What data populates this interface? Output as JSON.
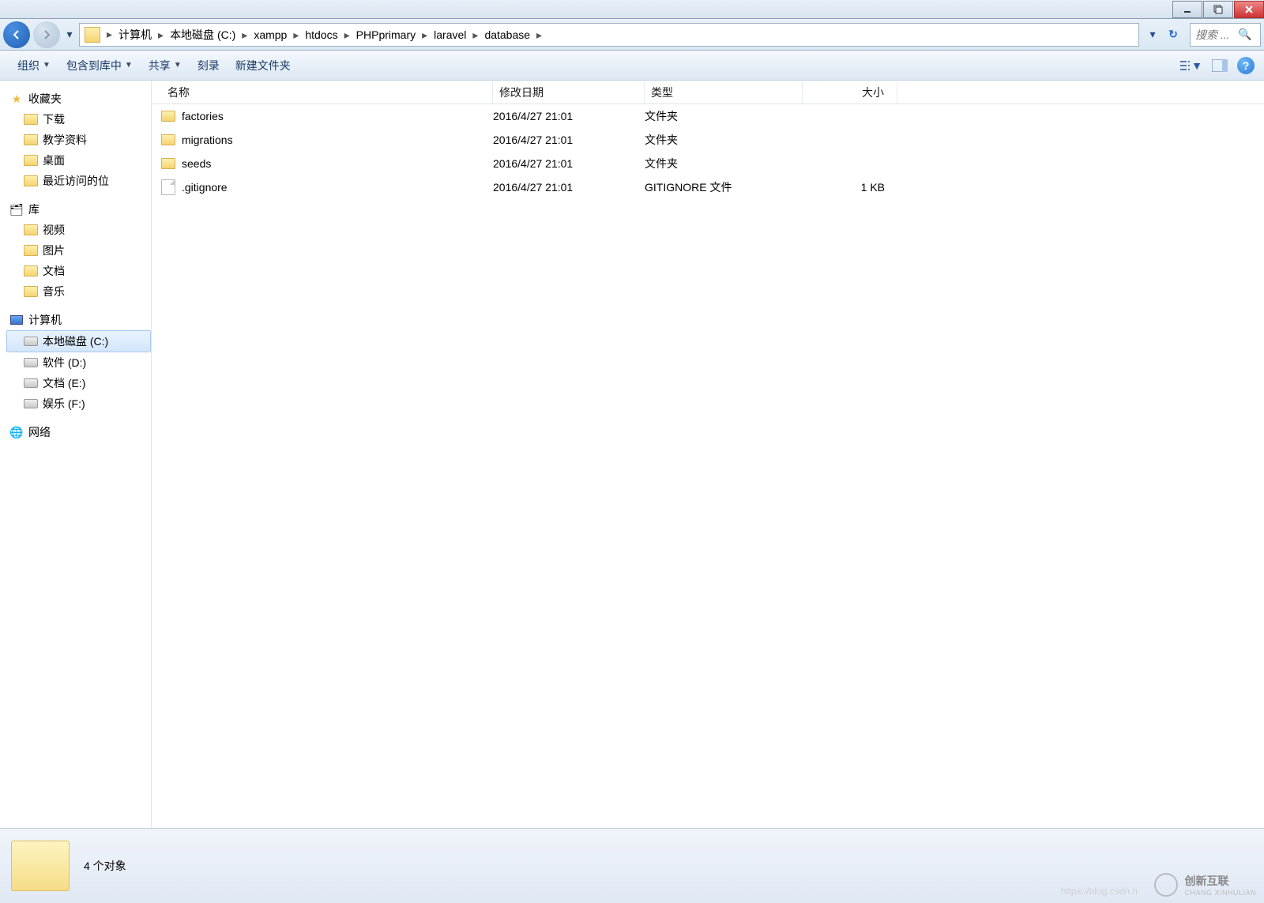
{
  "breadcrumbs": [
    "计算机",
    "本地磁盘 (C:)",
    "xampp",
    "htdocs",
    "PHPprimary",
    "laravel",
    "database"
  ],
  "search": {
    "placeholder": "搜索 ..."
  },
  "toolbar": {
    "organize": "组织",
    "include": "包含到库中",
    "share": "共享",
    "burn": "刻录",
    "newfolder": "新建文件夹"
  },
  "columns": {
    "name": "名称",
    "date": "修改日期",
    "type": "类型",
    "size": "大小"
  },
  "files": [
    {
      "icon": "folder",
      "name": "factories",
      "date": "2016/4/27 21:01",
      "type": "文件夹",
      "size": ""
    },
    {
      "icon": "folder",
      "name": "migrations",
      "date": "2016/4/27 21:01",
      "type": "文件夹",
      "size": ""
    },
    {
      "icon": "folder",
      "name": "seeds",
      "date": "2016/4/27 21:01",
      "type": "文件夹",
      "size": ""
    },
    {
      "icon": "file",
      "name": ".gitignore",
      "date": "2016/4/27 21:01",
      "type": "GITIGNORE 文件",
      "size": "1 KB"
    }
  ],
  "sidebar": {
    "favorites": {
      "label": "收藏夹",
      "items": [
        "下载",
        "教学资料",
        "桌面",
        "最近访问的位"
      ]
    },
    "libraries": {
      "label": "库",
      "items": [
        "视频",
        "图片",
        "文档",
        "音乐"
      ]
    },
    "computer": {
      "label": "计算机",
      "items": [
        "本地磁盘 (C:)",
        "软件 (D:)",
        "文档 (E:)",
        "娱乐 (F:)"
      ]
    },
    "network": {
      "label": "网络"
    }
  },
  "status": {
    "text": "4 个对象"
  },
  "watermark": {
    "brand": "创新互联",
    "sub": "CHANG XINHULIAN"
  },
  "faint": "https://blog.csdn.n"
}
